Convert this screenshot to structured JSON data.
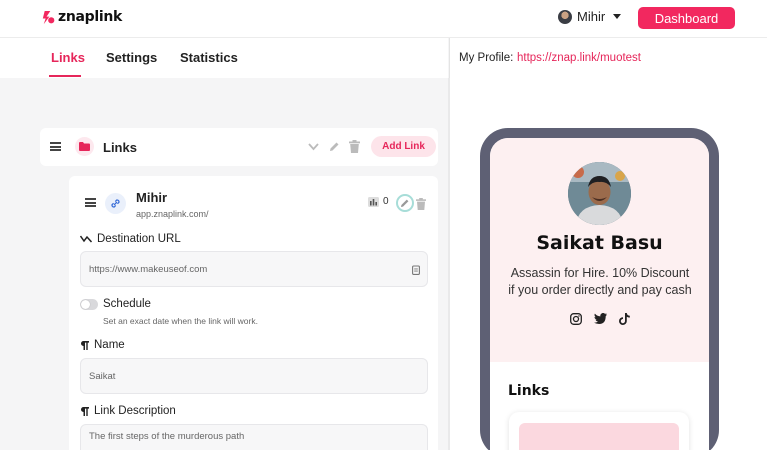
{
  "brand": {
    "name": "znaplink",
    "accent": "#f2285f"
  },
  "header": {
    "user_name": "Mihir",
    "dashboard_label": "Dashboard"
  },
  "tabs": [
    {
      "label": "Links",
      "active": true
    },
    {
      "label": "Settings",
      "active": false
    },
    {
      "label": "Statistics",
      "active": false
    }
  ],
  "profile": {
    "label": "My Profile:",
    "url": "https://znap.link/muotest"
  },
  "links_section": {
    "title": "Links",
    "add_label": "Add Link",
    "icons": [
      "drag-handle-icon",
      "folder-icon",
      "chevron-down-icon",
      "pencil-icon",
      "trash-icon"
    ]
  },
  "link_item": {
    "name": "Mihir",
    "url": "app.znaplink.com/",
    "click_count": "0",
    "destination": {
      "label": "Destination URL",
      "placeholder": "https://www.makeuseof.com"
    },
    "schedule": {
      "label": "Schedule",
      "help": "Set an exact date when the link will work.",
      "enabled": false
    },
    "name_field": {
      "label": "Name",
      "value": "Saikat"
    },
    "description_field": {
      "label": "Link Description",
      "value": "The first steps of the murderous path"
    }
  },
  "preview": {
    "name": "Saikat Basu",
    "bio": "Assassin for Hire. 10% Discount if you order directly and pay cash",
    "socials": [
      "instagram-icon",
      "twitter-icon",
      "tiktok-icon"
    ],
    "links_title": "Links"
  }
}
